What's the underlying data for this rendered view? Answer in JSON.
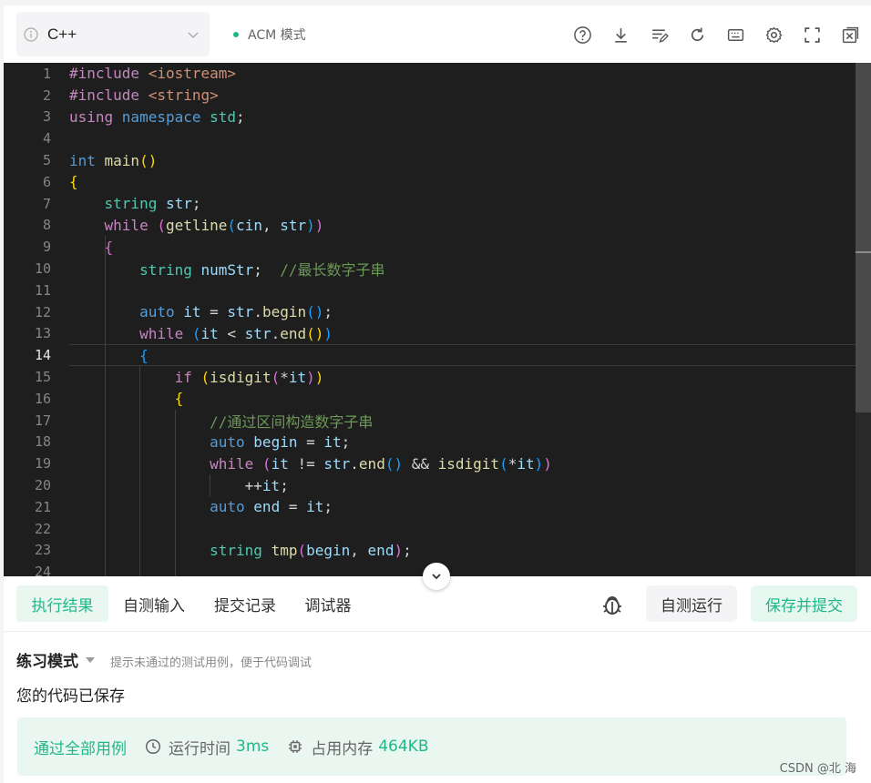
{
  "toolbar": {
    "language": "C++",
    "mode_label": "ACM 模式",
    "icons": [
      "help-icon",
      "download-icon",
      "format-icon",
      "reset-icon",
      "keyboard-icon",
      "settings-icon",
      "fullscreen-icon",
      "close-panel-icon"
    ]
  },
  "editor": {
    "active_line": 14,
    "lines": [
      {
        "n": "1",
        "segs": [
          [
            "pp",
            "#include "
          ],
          [
            "str",
            "<iostream>"
          ]
        ]
      },
      {
        "n": "2",
        "segs": [
          [
            "pp",
            "#include "
          ],
          [
            "str",
            "<string>"
          ]
        ]
      },
      {
        "n": "3",
        "segs": [
          [
            "kw",
            "using "
          ],
          [
            "bl",
            "namespace "
          ],
          [
            "ty",
            "std"
          ],
          [
            "",
            "; "
          ]
        ]
      },
      {
        "n": "4",
        "segs": []
      },
      {
        "n": "5",
        "segs": [
          [
            "bl",
            "int "
          ],
          [
            "fn",
            "main"
          ],
          [
            "br1",
            "()"
          ]
        ]
      },
      {
        "n": "6",
        "segs": [
          [
            "br1",
            "{"
          ]
        ]
      },
      {
        "n": "7",
        "segs": [
          [
            "",
            "    "
          ],
          [
            "ty",
            "string "
          ],
          [
            "vr",
            "str"
          ],
          [
            "",
            ";"
          ]
        ]
      },
      {
        "n": "8",
        "segs": [
          [
            "",
            "    "
          ],
          [
            "kw",
            "while "
          ],
          [
            "br2",
            "("
          ],
          [
            "fn",
            "getline"
          ],
          [
            "br3",
            "("
          ],
          [
            "vr",
            "cin"
          ],
          [
            "",
            ", "
          ],
          [
            "vr",
            "str"
          ],
          [
            "br3",
            ")"
          ],
          [
            "br2",
            ")"
          ]
        ]
      },
      {
        "n": "9",
        "segs": [
          [
            "",
            "    "
          ],
          [
            "br2",
            "{"
          ]
        ]
      },
      {
        "n": "10",
        "segs": [
          [
            "",
            "        "
          ],
          [
            "ty",
            "string "
          ],
          [
            "vr",
            "numStr"
          ],
          [
            "",
            ";  "
          ],
          [
            "cm",
            "//最长数字子串"
          ]
        ]
      },
      {
        "n": "11",
        "segs": []
      },
      {
        "n": "12",
        "segs": [
          [
            "",
            "        "
          ],
          [
            "bl",
            "auto "
          ],
          [
            "vr",
            "it "
          ],
          [
            "",
            "= "
          ],
          [
            "vr",
            "str"
          ],
          [
            "",
            "."
          ],
          [
            "fn",
            "begin"
          ],
          [
            "br3",
            "()"
          ],
          [
            "",
            ";"
          ]
        ]
      },
      {
        "n": "13",
        "segs": [
          [
            "",
            "        "
          ],
          [
            "kw",
            "while "
          ],
          [
            "br3",
            "("
          ],
          [
            "vr",
            "it "
          ],
          [
            "",
            "< "
          ],
          [
            "vr",
            "str"
          ],
          [
            "",
            "."
          ],
          [
            "fn",
            "end"
          ],
          [
            "br1",
            "()"
          ],
          [
            "br3",
            ")"
          ]
        ]
      },
      {
        "n": "14",
        "segs": [
          [
            "",
            "        "
          ],
          [
            "br3",
            "{"
          ]
        ]
      },
      {
        "n": "15",
        "segs": [
          [
            "",
            "            "
          ],
          [
            "kw",
            "if "
          ],
          [
            "br1",
            "("
          ],
          [
            "fn",
            "isdigit"
          ],
          [
            "br2",
            "("
          ],
          [
            "",
            "*"
          ],
          [
            "vr",
            "it"
          ],
          [
            "br2",
            ")"
          ],
          [
            "br1",
            ")"
          ]
        ]
      },
      {
        "n": "16",
        "segs": [
          [
            "",
            "            "
          ],
          [
            "br1",
            "{"
          ]
        ]
      },
      {
        "n": "17",
        "segs": [
          [
            "",
            "                "
          ],
          [
            "cm",
            "//通过区间构造数字子串"
          ]
        ]
      },
      {
        "n": "18",
        "segs": [
          [
            "",
            "                "
          ],
          [
            "bl",
            "auto "
          ],
          [
            "vr",
            "begin "
          ],
          [
            "",
            "= "
          ],
          [
            "vr",
            "it"
          ],
          [
            "",
            ";"
          ]
        ]
      },
      {
        "n": "19",
        "segs": [
          [
            "",
            "                "
          ],
          [
            "kw",
            "while "
          ],
          [
            "br2",
            "("
          ],
          [
            "vr",
            "it "
          ],
          [
            "",
            "!= "
          ],
          [
            "vr",
            "str"
          ],
          [
            "",
            "."
          ],
          [
            "fn",
            "end"
          ],
          [
            "br3",
            "()"
          ],
          [
            "",
            " && "
          ],
          [
            "fn",
            "isdigit"
          ],
          [
            "br3",
            "("
          ],
          [
            "",
            "*"
          ],
          [
            "vr",
            "it"
          ],
          [
            "br3",
            ")"
          ],
          [
            "br2",
            ")"
          ]
        ]
      },
      {
        "n": "20",
        "segs": [
          [
            "",
            "                    "
          ],
          [
            "",
            "++"
          ],
          [
            "vr",
            "it"
          ],
          [
            "",
            ";"
          ]
        ]
      },
      {
        "n": "21",
        "segs": [
          [
            "",
            "                "
          ],
          [
            "bl",
            "auto "
          ],
          [
            "vr",
            "end "
          ],
          [
            "",
            "= "
          ],
          [
            "vr",
            "it"
          ],
          [
            "",
            ";"
          ]
        ]
      },
      {
        "n": "22",
        "segs": []
      },
      {
        "n": "23",
        "segs": [
          [
            "",
            "                "
          ],
          [
            "ty",
            "string "
          ],
          [
            "fn",
            "tmp"
          ],
          [
            "br2",
            "("
          ],
          [
            "vr",
            "begin"
          ],
          [
            "",
            ", "
          ],
          [
            "vr",
            "end"
          ],
          [
            "br2",
            ")"
          ],
          [
            "",
            ";"
          ]
        ]
      },
      {
        "n": "24",
        "segs": []
      }
    ]
  },
  "tabs": {
    "items": [
      {
        "label": "执行结果",
        "active": true
      },
      {
        "label": "自测输入",
        "active": false
      },
      {
        "label": "提交记录",
        "active": false
      },
      {
        "label": "调试器",
        "active": false
      }
    ],
    "run_label": "自测运行",
    "submit_label": "保存并提交"
  },
  "result": {
    "mode": "练习模式",
    "hint": "提示未通过的测试用例，便于代码调试",
    "saved": "您的代码已保存",
    "pass": "通过全部用例",
    "time_label": "运行时间",
    "time_value": "3ms",
    "memory_label": "占用内存",
    "memory_value": "464KB"
  },
  "watermark": "CSDN @北   海",
  "colors": {
    "accent": "#1fb88a",
    "editor_bg": "#1e1e1e"
  }
}
